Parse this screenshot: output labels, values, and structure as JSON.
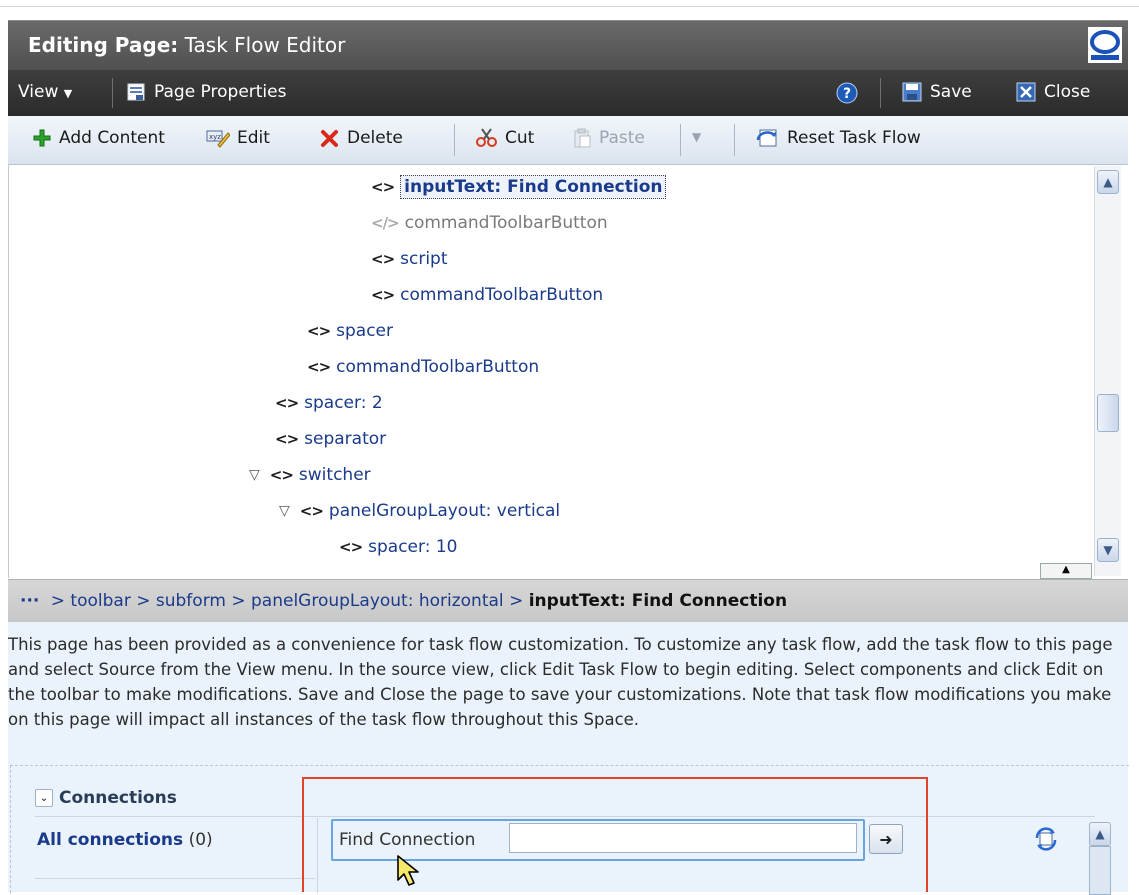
{
  "window": {
    "title_label": "Editing Page:",
    "title_value": "Task Flow Editor"
  },
  "menubar": {
    "view_label": "View",
    "page_properties_label": "Page Properties",
    "save_label": "Save",
    "close_label": "Close"
  },
  "toolbar": {
    "add_content_label": "Add Content",
    "edit_label": "Edit",
    "delete_label": "Delete",
    "cut_label": "Cut",
    "paste_label": "Paste",
    "reset_task_flow_label": "Reset Task Flow"
  },
  "tree": {
    "nodes": [
      {
        "label": "inputText: Find Connection",
        "selected": true
      },
      {
        "label": "commandToolbarButton",
        "disabled": true
      },
      {
        "label": "script"
      },
      {
        "label": "commandToolbarButton"
      },
      {
        "label": "spacer"
      },
      {
        "label": "commandToolbarButton"
      },
      {
        "label": "spacer: 2"
      },
      {
        "label": "separator"
      },
      {
        "label": "switcher",
        "expanded": true
      },
      {
        "label": "panelGroupLayout: vertical",
        "expanded": true
      },
      {
        "label": "spacer: 10"
      }
    ]
  },
  "breadcrumb": {
    "ellipsis": "···",
    "path": [
      " > toolbar",
      " > subform",
      " > panelGroupLayout: horizontal",
      " > "
    ],
    "current": "inputText: Find Connection"
  },
  "info": {
    "text": "This page has been provided as a convenience for task flow customization. To customize any task flow, add the task flow to this page and select Source from the View menu. In the source view, click Edit Task Flow to begin editing. Select components and click Edit on the toolbar to make modifications. Save and Close the page to save your customizations. Note that task flow modifications you make on this page will impact all instances of the task flow throughout this Space."
  },
  "connections": {
    "header": "Connections",
    "all_connections_label": "All connections",
    "all_connections_count": "(0)",
    "find_label": "Find Connection",
    "find_value": ""
  },
  "colors": {
    "highlight": "#e0452a",
    "title_bar": "#5a5a5a",
    "menubar": "#333333",
    "link": "#1a3a8a",
    "info_bg": "#eaf3fb"
  }
}
